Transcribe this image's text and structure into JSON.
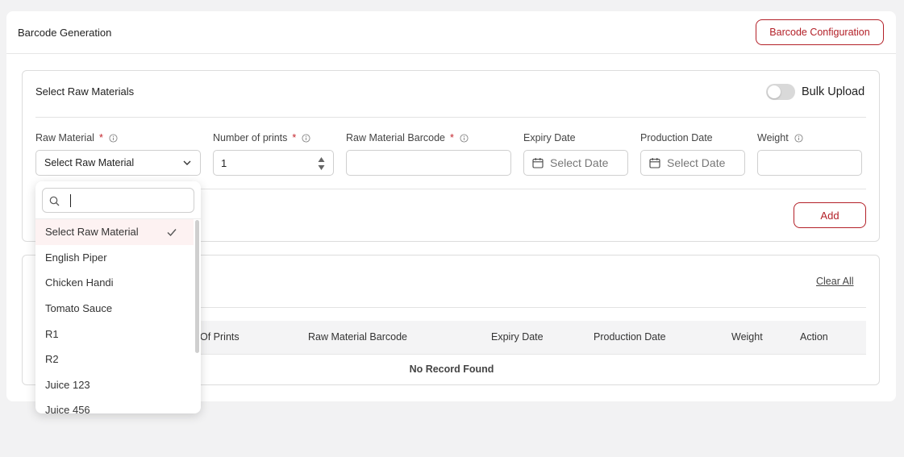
{
  "header": {
    "title": "Barcode Generation",
    "config_button": "Barcode Configuration"
  },
  "form": {
    "section_title": "Select Raw Materials",
    "bulk_upload_label": "Bulk Upload",
    "bulk_upload_enabled": false,
    "labels": {
      "raw_material": "Raw Material",
      "number_of_prints": "Number of prints",
      "raw_material_barcode": "Raw Material Barcode",
      "expiry_date": "Expiry Date",
      "production_date": "Production Date",
      "weight": "Weight"
    },
    "required_mark": "*",
    "raw_material_value": "Select Raw Material",
    "number_of_prints_value": "1",
    "barcode_value": "",
    "expiry_placeholder": "Select Date",
    "production_placeholder": "Select Date",
    "weight_value": "",
    "add_button": "Add"
  },
  "table": {
    "clear_all": "Clear All",
    "columns": [
      "Of Prints",
      "Raw Material Barcode",
      "Expiry Date",
      "Production Date",
      "Weight",
      "Action"
    ],
    "empty_text": "No Record Found"
  },
  "dropdown": {
    "search_value": "",
    "options": [
      "Select Raw Material",
      "English Piper",
      "Chicken Handi",
      "Tomato Sauce",
      "R1",
      "R2",
      "Juice 123",
      "Juice 456"
    ],
    "selected_index": 0
  },
  "colors": {
    "accent": "#b32028",
    "required": "#c4242c",
    "background": "#f2f2f3"
  },
  "icons": [
    "info-icon",
    "chevron-down-icon",
    "spinner-arrows-icon",
    "calendar-icon",
    "search-icon",
    "check-icon"
  ]
}
